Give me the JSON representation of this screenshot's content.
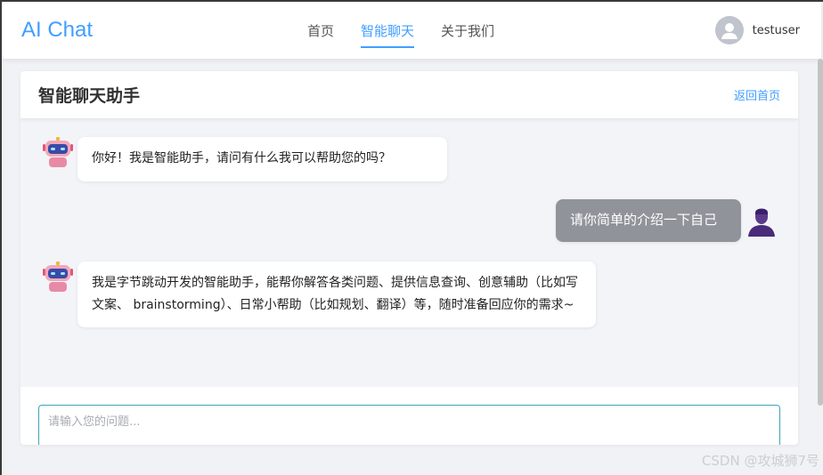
{
  "header": {
    "logo": "AI Chat",
    "nav": [
      {
        "label": "首页",
        "active": false
      },
      {
        "label": "智能聊天",
        "active": true
      },
      {
        "label": "关于我们",
        "active": false
      }
    ],
    "username": "testuser"
  },
  "chat": {
    "title": "智能聊天助手",
    "back_label": "返回首页",
    "messages": [
      {
        "role": "bot",
        "text": "你好！我是智能助手，请问有什么我可以帮助您的吗？"
      },
      {
        "role": "user",
        "text": "请你简单的介绍一下自己"
      },
      {
        "role": "bot",
        "text": "我是字节跳动开发的智能助手，能帮你解答各类问题、提供信息查询、创意辅助（比如写文案、 brainstorming）、日常小帮助（比如规划、翻译）等，随时准备回应你的需求~"
      }
    ],
    "input_placeholder": "请输入您的问题..."
  },
  "watermark": "CSDN @攻城狮7号",
  "colors": {
    "accent": "#409eff",
    "user_bubble": "#909399",
    "input_border": "#3ca6b6"
  }
}
